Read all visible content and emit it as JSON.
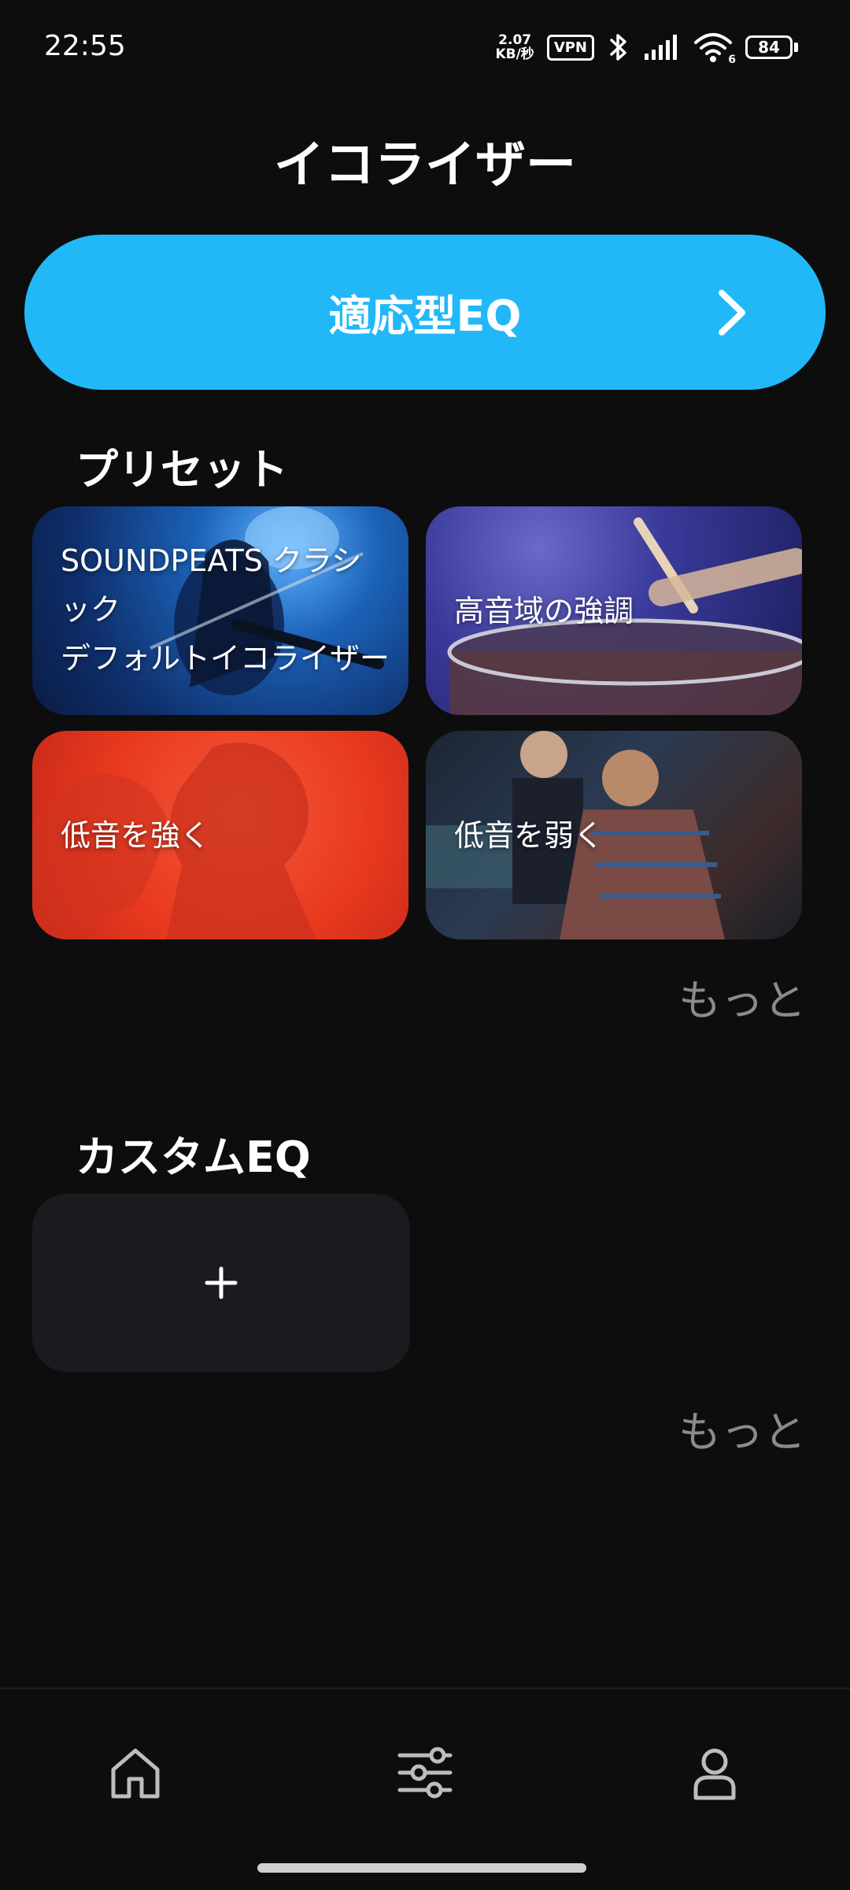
{
  "status_bar": {
    "time": "22:55",
    "net_speed_value": "2.07",
    "net_speed_unit": "KB/秒",
    "vpn": "VPN",
    "signal_label": "6",
    "battery": "84"
  },
  "page_title": "イコライザー",
  "adaptive_eq": {
    "label": "適応型EQ"
  },
  "presets": {
    "title": "プリセット",
    "cards": [
      {
        "name": "SOUNDPEATS クラシック",
        "subtitle": "デフォルトイコライザー"
      },
      {
        "name": "高音域の強調"
      },
      {
        "name": "低音を強く"
      },
      {
        "name": "低音を弱く"
      }
    ],
    "more": "もっと"
  },
  "custom_eq": {
    "title": "カスタムEQ",
    "add": "+",
    "more": "もっと"
  },
  "bottom_nav": {
    "items": [
      {
        "icon": "home-icon"
      },
      {
        "icon": "equalizer-icon"
      },
      {
        "icon": "profile-icon"
      }
    ]
  },
  "colors": {
    "background": "#0d0d0d",
    "accent": "#22b8f8",
    "more_text": "#8a8a8a",
    "card_surface": "#1a1b1f"
  }
}
